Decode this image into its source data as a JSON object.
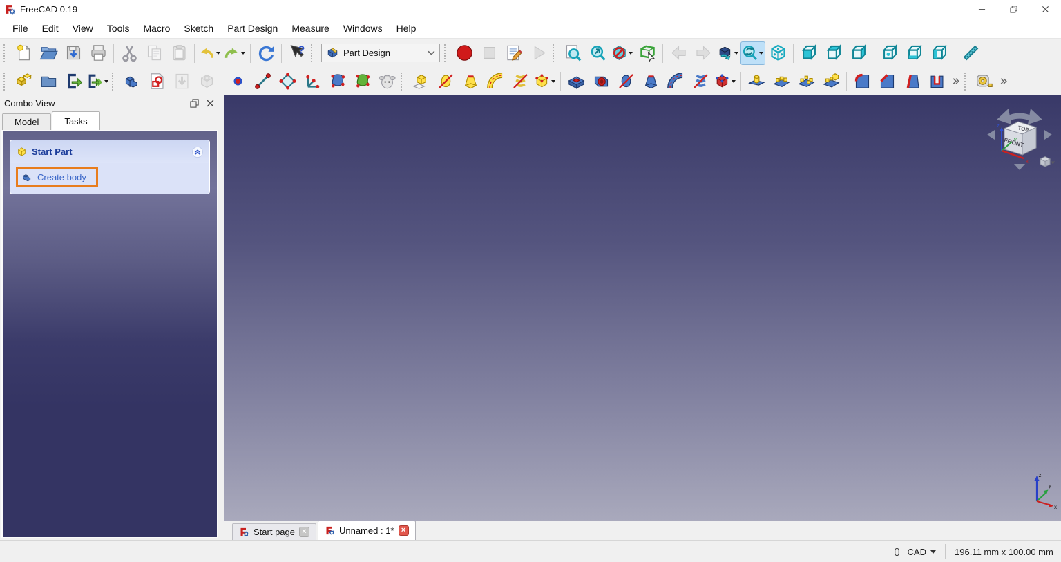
{
  "window": {
    "title": "FreeCAD 0.19"
  },
  "window_controls": [
    "minimize",
    "restore",
    "close"
  ],
  "menubar": [
    "File",
    "Edit",
    "View",
    "Tools",
    "Macro",
    "Sketch",
    "Part Design",
    "Measure",
    "Windows",
    "Help"
  ],
  "workbench_selector": {
    "value": "Part Design",
    "icon": "wb-partdesign"
  },
  "toolbar_row1": [
    {
      "type": "handle"
    },
    {
      "type": "button",
      "name": "new-document",
      "icon": "doc-new"
    },
    {
      "type": "button",
      "name": "open-document",
      "icon": "folder-open"
    },
    {
      "type": "button",
      "name": "save-document",
      "icon": "save"
    },
    {
      "type": "button",
      "name": "print",
      "icon": "print"
    },
    {
      "type": "sep"
    },
    {
      "type": "button",
      "name": "cut",
      "icon": "cut"
    },
    {
      "type": "button",
      "name": "copy",
      "icon": "copy",
      "disabled": true
    },
    {
      "type": "button",
      "name": "paste",
      "icon": "paste",
      "disabled": true
    },
    {
      "type": "sep"
    },
    {
      "type": "button",
      "name": "undo",
      "icon": "undo",
      "dropdown": true
    },
    {
      "type": "button",
      "name": "redo",
      "icon": "redo",
      "dropdown": true
    },
    {
      "type": "sep"
    },
    {
      "type": "button",
      "name": "refresh-document",
      "icon": "refresh"
    },
    {
      "type": "sep"
    },
    {
      "type": "button",
      "name": "whats-this-help",
      "icon": "whats-this"
    },
    {
      "type": "handle"
    },
    {
      "type": "workbench"
    },
    {
      "type": "handle"
    },
    {
      "type": "button",
      "name": "macro-record",
      "icon": "macro-record"
    },
    {
      "type": "button",
      "name": "macro-stop",
      "icon": "macro-stop",
      "disabled": true
    },
    {
      "type": "button",
      "name": "macro-edit",
      "icon": "macro-edit"
    },
    {
      "type": "button",
      "name": "macro-execute",
      "icon": "macro-play",
      "disabled": true
    },
    {
      "type": "handle"
    },
    {
      "type": "button",
      "name": "fit-all",
      "icon": "fit-all"
    },
    {
      "type": "button",
      "name": "fit-selection",
      "icon": "zoom-selection"
    },
    {
      "type": "button",
      "name": "draw-style",
      "icon": "draw-style",
      "dropdown": true
    },
    {
      "type": "button",
      "name": "selection-bounding-box",
      "icon": "bounding-box"
    },
    {
      "type": "sep"
    },
    {
      "type": "button",
      "name": "navigate-back",
      "icon": "nav-back",
      "disabled": true
    },
    {
      "type": "button",
      "name": "navigate-forward",
      "icon": "nav-forward",
      "disabled": true
    },
    {
      "type": "button",
      "name": "link-navigation",
      "icon": "link-cube",
      "dropdown": true
    },
    {
      "type": "button",
      "name": "sync-view",
      "icon": "sync-view",
      "dropdown": true,
      "active": true
    },
    {
      "type": "button",
      "name": "axonometric-view",
      "icon": "view-axonometric"
    },
    {
      "type": "sep"
    },
    {
      "type": "button",
      "name": "view-front",
      "icon": "view-front"
    },
    {
      "type": "button",
      "name": "view-top",
      "icon": "view-top"
    },
    {
      "type": "button",
      "name": "view-right",
      "icon": "view-right"
    },
    {
      "type": "sep"
    },
    {
      "type": "button",
      "name": "view-rear",
      "icon": "view-rear"
    },
    {
      "type": "button",
      "name": "view-bottom",
      "icon": "view-bottom"
    },
    {
      "type": "button",
      "name": "view-left",
      "icon": "view-left"
    },
    {
      "type": "sep"
    },
    {
      "type": "button",
      "name": "measure-distance",
      "icon": "ruler"
    }
  ],
  "toolbar_row2": [
    {
      "type": "handle"
    },
    {
      "type": "button",
      "name": "create-part",
      "icon": "create-part"
    },
    {
      "type": "button",
      "name": "create-group",
      "icon": "create-group"
    },
    {
      "type": "button",
      "name": "make-link",
      "icon": "make-link"
    },
    {
      "type": "button",
      "name": "make-link-group",
      "icon": "make-link-group",
      "dropdown": true
    },
    {
      "type": "handle"
    },
    {
      "type": "button",
      "name": "create-body",
      "icon": "create-body"
    },
    {
      "type": "button",
      "name": "create-sketch",
      "icon": "create-sketch"
    },
    {
      "type": "button",
      "name": "map-sketch-to-face",
      "icon": "map-sketch",
      "disabled": true
    },
    {
      "type": "button",
      "name": "validate-sketch",
      "icon": "validate-sketch",
      "disabled": true
    },
    {
      "type": "sep"
    },
    {
      "type": "button",
      "name": "datum-point",
      "icon": "datum-point"
    },
    {
      "type": "button",
      "name": "datum-line",
      "icon": "datum-line"
    },
    {
      "type": "button",
      "name": "datum-plane",
      "icon": "datum-plane"
    },
    {
      "type": "button",
      "name": "local-coordinate-system",
      "icon": "local-cs"
    },
    {
      "type": "button",
      "name": "shape-binder",
      "icon": "shape-binder"
    },
    {
      "type": "button",
      "name": "sub-shape-binder",
      "icon": "sub-shape-binder"
    },
    {
      "type": "button",
      "name": "clone",
      "icon": "clone"
    },
    {
      "type": "handle"
    },
    {
      "type": "button",
      "name": "pad",
      "icon": "pad"
    },
    {
      "type": "button",
      "name": "revolution",
      "icon": "revolution"
    },
    {
      "type": "button",
      "name": "additive-loft",
      "icon": "additive-loft"
    },
    {
      "type": "button",
      "name": "additive-pipe",
      "icon": "additive-pipe"
    },
    {
      "type": "button",
      "name": "additive-helix",
      "icon": "additive-helix"
    },
    {
      "type": "button",
      "name": "additive-primitive",
      "icon": "additive-primitive",
      "dropdown": true
    },
    {
      "type": "sep"
    },
    {
      "type": "button",
      "name": "pocket",
      "icon": "pocket"
    },
    {
      "type": "button",
      "name": "hole",
      "icon": "hole"
    },
    {
      "type": "button",
      "name": "groove",
      "icon": "groove"
    },
    {
      "type": "button",
      "name": "subtractive-loft",
      "icon": "subtractive-loft"
    },
    {
      "type": "button",
      "name": "subtractive-pipe",
      "icon": "subtractive-pipe"
    },
    {
      "type": "button",
      "name": "subtractive-helix",
      "icon": "subtractive-helix"
    },
    {
      "type": "button",
      "name": "subtractive-primitive",
      "icon": "subtractive-primitive",
      "dropdown": true
    },
    {
      "type": "sep"
    },
    {
      "type": "button",
      "name": "mirrored",
      "icon": "mirrored"
    },
    {
      "type": "button",
      "name": "linear-pattern",
      "icon": "linear-pattern"
    },
    {
      "type": "button",
      "name": "polar-pattern",
      "icon": "polar-pattern"
    },
    {
      "type": "button",
      "name": "multi-transform",
      "icon": "multi-transform"
    },
    {
      "type": "sep"
    },
    {
      "type": "button",
      "name": "fillet",
      "icon": "fillet"
    },
    {
      "type": "button",
      "name": "chamfer",
      "icon": "chamfer"
    },
    {
      "type": "button",
      "name": "draft",
      "icon": "draft"
    },
    {
      "type": "button",
      "name": "thickness",
      "icon": "thickness"
    },
    {
      "type": "button",
      "name": "toolbar-extension",
      "icon": "overflow"
    },
    {
      "type": "handle"
    },
    {
      "type": "button",
      "name": "measure-linear",
      "icon": "tape-measure"
    },
    {
      "type": "button",
      "name": "toolbar-extension-2",
      "icon": "overflow"
    }
  ],
  "combo_view": {
    "title": "Combo View",
    "header_icons": [
      "float-window",
      "close-x"
    ],
    "tabs": [
      {
        "label": "Model",
        "active": false
      },
      {
        "label": "Tasks",
        "active": true
      }
    ],
    "task_panel": {
      "section": {
        "title": "Start Part",
        "icon": "part-box",
        "collapse_icon": "collapse-up"
      },
      "items": [
        {
          "label": "Create body",
          "icon": "create-body",
          "highlighted": true
        }
      ]
    }
  },
  "viewport": {
    "navigation_cube": {
      "visible_faces": [
        "TOP",
        "FRONT"
      ]
    },
    "axis_indicator": {
      "axes": [
        "x",
        "y",
        "z"
      ]
    }
  },
  "mdi_tabs": [
    {
      "label": "Start page",
      "active": false
    },
    {
      "label": "Unnamed : 1*",
      "active": true
    }
  ],
  "status_bar": {
    "navigation_style": "CAD",
    "dimensions": "196.11 mm x 100.00 mm"
  },
  "colors": {
    "highlight_annotation": "#e87d1d",
    "active_tool_bg": "#bee0f8",
    "viewport_top": "#393968",
    "viewport_bottom": "#a9a9bc",
    "panel_bottom": "#343463",
    "start_part_title": "#1d3e9b",
    "task_link": "#3a66c8"
  }
}
